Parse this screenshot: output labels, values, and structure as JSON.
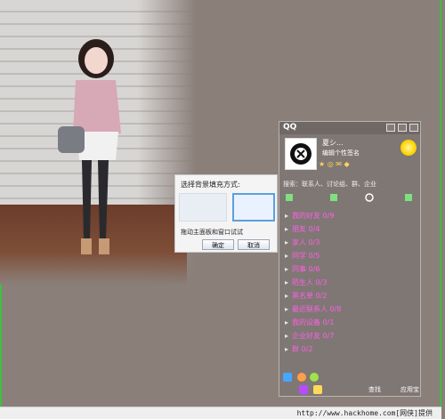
{
  "wallpaper": {
    "scene": "brick wall photo background"
  },
  "dialog": {
    "title": "选择背景填充方式:",
    "hint": "拖动主面板和窗口试试",
    "ok_label": "确定",
    "cancel_label": "取消"
  },
  "qq": {
    "app_title": "QQ",
    "nickname": "夏シ...",
    "signature": "编辑个性签名",
    "search_text": "搜索：联系人、讨论组、群、企业",
    "groups": [
      {
        "label": "我的好友 0/9"
      },
      {
        "label": "朋友 0/4"
      },
      {
        "label": "家人 0/3"
      },
      {
        "label": "同学 0/5"
      },
      {
        "label": "同事 0/6"
      },
      {
        "label": "陌生人 0/3"
      },
      {
        "label": "黑名单 0/2"
      },
      {
        "label": "最近联系人 0/8"
      },
      {
        "label": "我的设备 0/1"
      },
      {
        "label": "企业好友 0/7"
      },
      {
        "label": "群 0/2"
      }
    ],
    "footer_find": "查找",
    "footer_apps": "应用宝"
  },
  "footer": {
    "credit": "http://www.hackhome.com[网侠]提供"
  },
  "colors": {
    "accent_pink": "#ff5fe6",
    "panel_bg": "#7f7774",
    "dialog_accent": "#5aa0e0"
  }
}
